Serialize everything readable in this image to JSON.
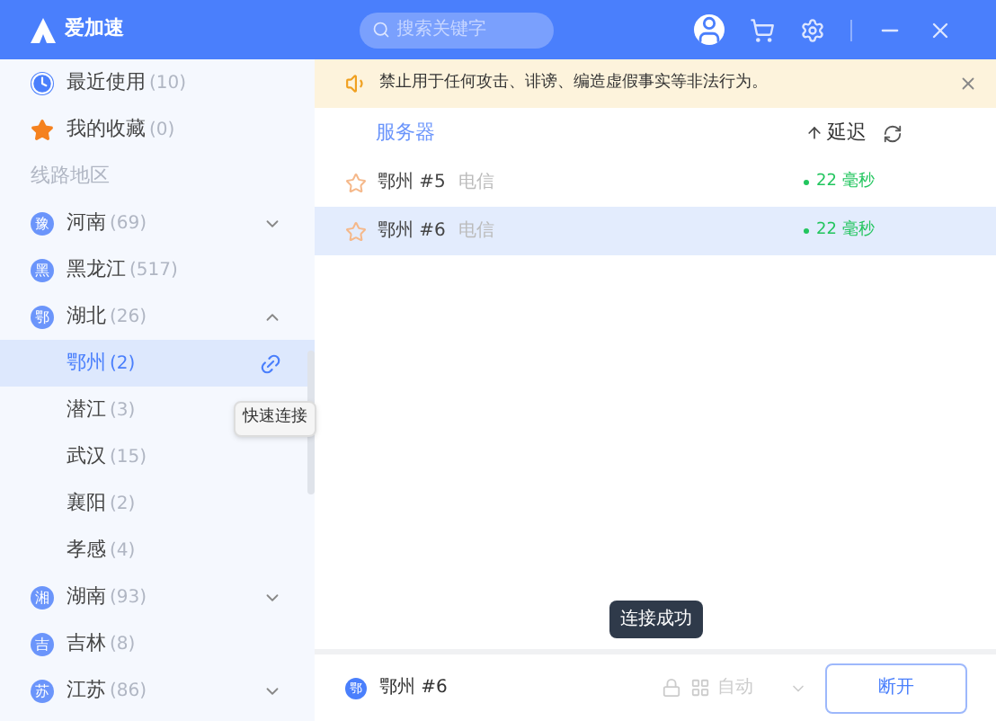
{
  "app": {
    "name": "爱加速"
  },
  "search": {
    "placeholder": "搜索关键字"
  },
  "notice": {
    "text": "禁止用于任何攻击、诽谤、编造虚假事实等非法行为。"
  },
  "sidebar": {
    "items": [
      {
        "kind": "recent",
        "label": "最近使用",
        "count": "(10)",
        "selected": false
      },
      {
        "kind": "favorite",
        "label": "我的收藏",
        "count": "(0)",
        "selected": false
      },
      {
        "kind": "header",
        "label": "线路地区"
      },
      {
        "kind": "province",
        "badge": "豫",
        "label": "河南",
        "count": "(69)",
        "expanded": false,
        "selected": false
      },
      {
        "kind": "province",
        "badge": "黑",
        "label": "黑龙江",
        "count": "(517)",
        "selected": false
      },
      {
        "kind": "province",
        "badge": "鄂",
        "label": "湖北",
        "count": "(26)",
        "expanded": true,
        "selected": false
      },
      {
        "kind": "city",
        "label": "鄂州",
        "count": "(2)",
        "selected": true
      },
      {
        "kind": "city",
        "label": "潜江",
        "count": "(3)",
        "selected": false
      },
      {
        "kind": "city",
        "label": "武汉",
        "count": "(15)",
        "selected": false
      },
      {
        "kind": "city",
        "label": "襄阳",
        "count": "(2)",
        "selected": false
      },
      {
        "kind": "city",
        "label": "孝感",
        "count": "(4)",
        "selected": false
      },
      {
        "kind": "province",
        "badge": "湘",
        "label": "湖南",
        "count": "(93)",
        "expanded": false,
        "selected": false
      },
      {
        "kind": "province",
        "badge": "吉",
        "label": "吉林",
        "count": "(8)",
        "selected": false
      },
      {
        "kind": "province",
        "badge": "苏",
        "label": "江苏",
        "count": "(86)",
        "expanded": false,
        "selected": false
      }
    ]
  },
  "tooltip": {
    "text": "快速连接"
  },
  "table": {
    "columns": [
      "服务器",
      "延迟"
    ],
    "rows": [
      {
        "name": "鄂州 #5",
        "isp": "电信",
        "latency": "22 毫秒",
        "selected": false
      },
      {
        "name": "鄂州 #6",
        "isp": "电信",
        "latency": "22 毫秒",
        "selected": true
      }
    ]
  },
  "toast": {
    "text": "连接成功"
  },
  "status_bar": {
    "badge": "鄂",
    "server": "鄂州 #6",
    "mode": "自动",
    "button": "断开"
  }
}
